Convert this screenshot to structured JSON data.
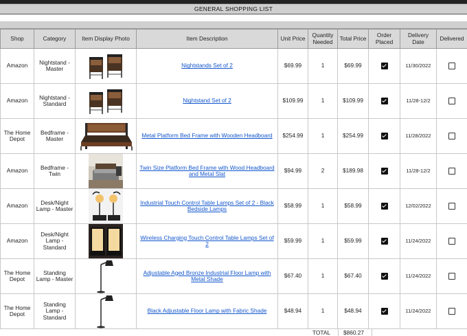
{
  "title": "GENERAL SHOPPING LIST",
  "headers": {
    "shop": "Shop",
    "category": "Category",
    "photo": "Item Display Photo",
    "description": "Item Description",
    "unit_price": "Unit Price",
    "qty": "Quantity Needed",
    "total": "Total Price",
    "placed": "Order Placed",
    "delivery_date": "Delivery Date",
    "delivered": "Delivered"
  },
  "rows": [
    {
      "shop": "Amazon",
      "category": "Nightstand - Master",
      "photo": "nightstand-photo",
      "description": "Nightstands Set of 2",
      "unit_price": "$69.99",
      "qty": "1",
      "total": "$69.99",
      "placed": true,
      "delivery_date": "11/30/2022",
      "delivered": false
    },
    {
      "shop": "Amazon",
      "category": "Nightstand - Standard",
      "photo": "nightstand-photo",
      "description": "Nightstand Set of 2",
      "unit_price": "$109.99",
      "qty": "1",
      "total": "$109.99",
      "placed": true,
      "delivery_date": "11/28-12/2",
      "delivered": false
    },
    {
      "shop": "The Home Depot",
      "category": "Bedframe - Master",
      "photo": "bedframe-photo",
      "description": "Metal Platform Bed Frame with Wooden Headboard",
      "unit_price": "$254.99",
      "qty": "1",
      "total": "$254.99",
      "placed": true,
      "delivery_date": "11/28/2022",
      "delivered": false
    },
    {
      "shop": "Amazon",
      "category": "Bedframe - Twin",
      "photo": "bedroom-photo",
      "description": "Twin Size Platform Bed Frame with Wood Headboard and Metal Slat",
      "unit_price": "$94.99",
      "qty": "2",
      "total": "$189.98",
      "placed": true,
      "delivery_date": "11/28-12/2",
      "delivered": false
    },
    {
      "shop": "Amazon",
      "category": "Desk/Night Lamp - Master",
      "photo": "table-lamp-photo",
      "description": "Industrial Touch Control Table Lamps Set of 2 - Black Bedside Lamps",
      "unit_price": "$58.99",
      "qty": "1",
      "total": "$58.99",
      "placed": true,
      "delivery_date": "12/02/2022",
      "delivered": false
    },
    {
      "shop": "Amazon",
      "category": "Desk/Night Lamp - Standard",
      "photo": "charging-lamp-photo",
      "description": "Wireless Charging Touch Control Table Lamps Set of 2",
      "unit_price": "$59.99",
      "qty": "1",
      "total": "$59.99",
      "placed": true,
      "delivery_date": "11/24/2022",
      "delivered": false
    },
    {
      "shop": "The Home Depot",
      "category": "Standing Lamp - Master",
      "photo": "floor-lamp-photo",
      "description": "Adjustable Aged Bronze Industrial Floor Lamp with Metal Shade",
      "unit_price": "$67.40",
      "qty": "1",
      "total": "$67.40",
      "placed": true,
      "delivery_date": "11/24/2022",
      "delivered": false
    },
    {
      "shop": "The Home Depot",
      "category": "Standing Lamp - Standard",
      "photo": "floor-lamp-photo",
      "description": "Black Adjustable Floor Lamp with Fabric Shade",
      "unit_price": "$48.94",
      "qty": "1",
      "total": "$48.94",
      "placed": true,
      "delivery_date": "11/24/2022",
      "delivered": false
    }
  ],
  "total_label": "TOTAL",
  "total_value": "$860.27",
  "colors": {
    "header_bg": "#d9d9d9",
    "link": "#1155cc",
    "top_bar": "#222222"
  }
}
